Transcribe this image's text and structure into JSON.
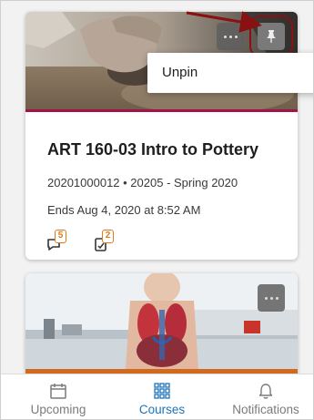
{
  "colors": {
    "accent": "#1a73b9",
    "badge": "#e07a1c",
    "banner_stripe_1": "#a3154a",
    "banner_stripe_2": "#d16a1e",
    "annotation": "#8a1111"
  },
  "cards": [
    {
      "image": "pottery-hands-clay",
      "title": "ART 160-03 Intro to Pottery",
      "meta": "20201000012 • 20205 - Spring 2020",
      "ends": "Ends Aug 4, 2020 at 8:52 AM",
      "activity": [
        {
          "icon": "discussion-icon",
          "count": "5"
        },
        {
          "icon": "assignment-icon",
          "count": "2"
        }
      ],
      "pinned": true
    },
    {
      "image": "anatomy-model-lab",
      "pinned": false
    }
  ],
  "context_menu": {
    "items": [
      {
        "label": "Unpin"
      }
    ]
  },
  "tabbar": {
    "tabs": [
      {
        "label": "Upcoming",
        "icon": "calendar-icon",
        "active": false
      },
      {
        "label": "Courses",
        "icon": "grid-icon",
        "active": true
      },
      {
        "label": "Notifications",
        "icon": "bell-icon",
        "active": false
      }
    ]
  }
}
